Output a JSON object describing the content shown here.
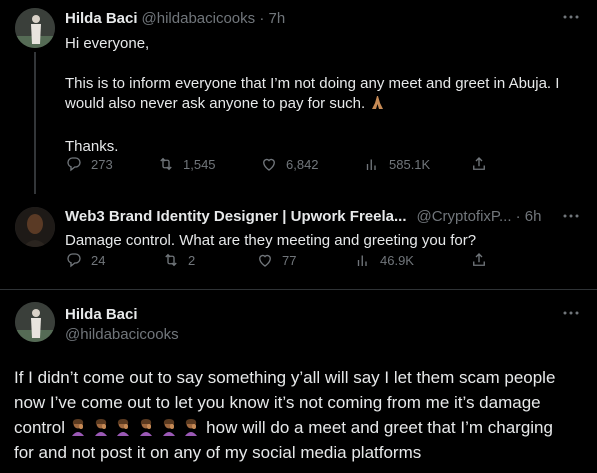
{
  "tweet1": {
    "name": "Hilda Baci",
    "handle": "@hildabacicooks · 7h",
    "line1": "Hi everyone,",
    "line2": "This is to inform everyone that I’m not doing any meet and greet in Abuja. I",
    "line3": "would also never ask anyone to pay for such.",
    "line4": "Thanks.",
    "replies": "273",
    "retweets": "1,545",
    "likes": "6,842",
    "views": "585.1K"
  },
  "tweet2": {
    "name": "Web3 Brand Identity Designer | Upwork Freela...",
    "handle": "@CryptofixP... · 6h",
    "text": "Damage control. What are they meeting and greeting you for?",
    "replies": "24",
    "retweets": "2",
    "likes": "77",
    "views": "46.9K"
  },
  "tweet3": {
    "name": "Hilda Baci",
    "handle": "@hildabacicooks",
    "line1": "If I didn’t come out to say something y’all will say I let them scam people",
    "line2": "now I’ve come out to let you know it’s not coming from me it’s damage",
    "line3_start": "control",
    "line3_end": "how will do a meet and greet that I’m charging",
    "line4": "for and not post it on any of my social media platforms"
  },
  "icons": {
    "more": "more-horizontal-icon",
    "reply": "reply-icon",
    "retweet": "retweet-icon",
    "like": "like-icon",
    "views": "views-icon",
    "share": "share-icon"
  },
  "colors": {
    "background": "#000000",
    "text": "#e7e9ea",
    "secondary": "#71767b",
    "divider": "#2f3336"
  }
}
